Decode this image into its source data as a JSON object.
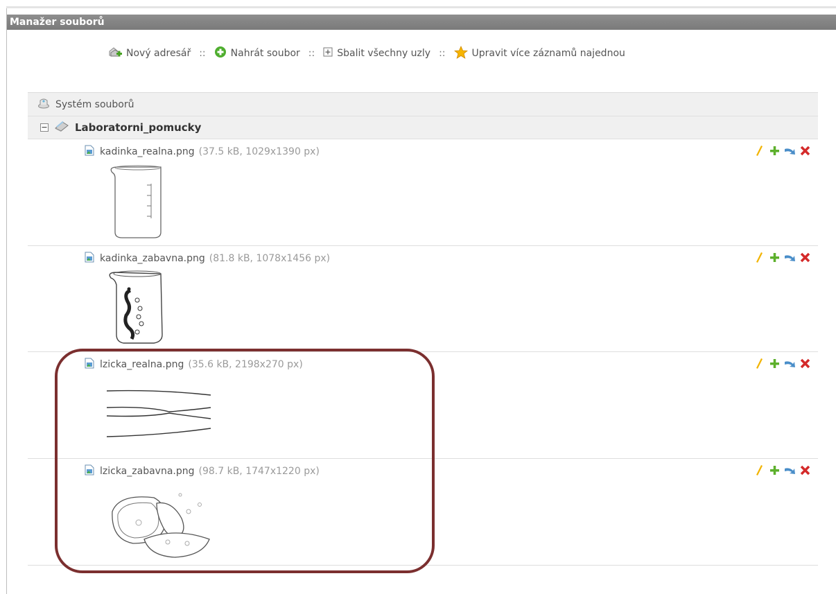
{
  "window": {
    "title": "Manažer souborů"
  },
  "toolbar": {
    "new_dir": "Nový adresář",
    "upload": "Nahrát soubor",
    "collapse": "Sbalit všechny uzly",
    "multi_edit": "Upravit více záznamů najednou",
    "separator": "::"
  },
  "tree": {
    "root_label": "Systém souborů",
    "folder_label": "Laboratorni_pomucky",
    "files": [
      {
        "name": "kadinka_realna.png",
        "meta": "(37.5 kB, 1029x1390 px)"
      },
      {
        "name": "kadinka_zabavna.png",
        "meta": "(81.8 kB, 1078x1456 px)"
      },
      {
        "name": "lzicka_realna.png",
        "meta": "(35.6 kB, 2198x270 px)"
      },
      {
        "name": "lzicka_zabavna.png",
        "meta": "(98.7 kB, 1747x1220 px)"
      }
    ]
  },
  "colors": {
    "titlebar": "#808080",
    "highlight": "#7b2f2f",
    "edit": "#f2b400",
    "add": "#5db02c",
    "move": "#4a8ec9",
    "delete": "#d42a2a"
  }
}
